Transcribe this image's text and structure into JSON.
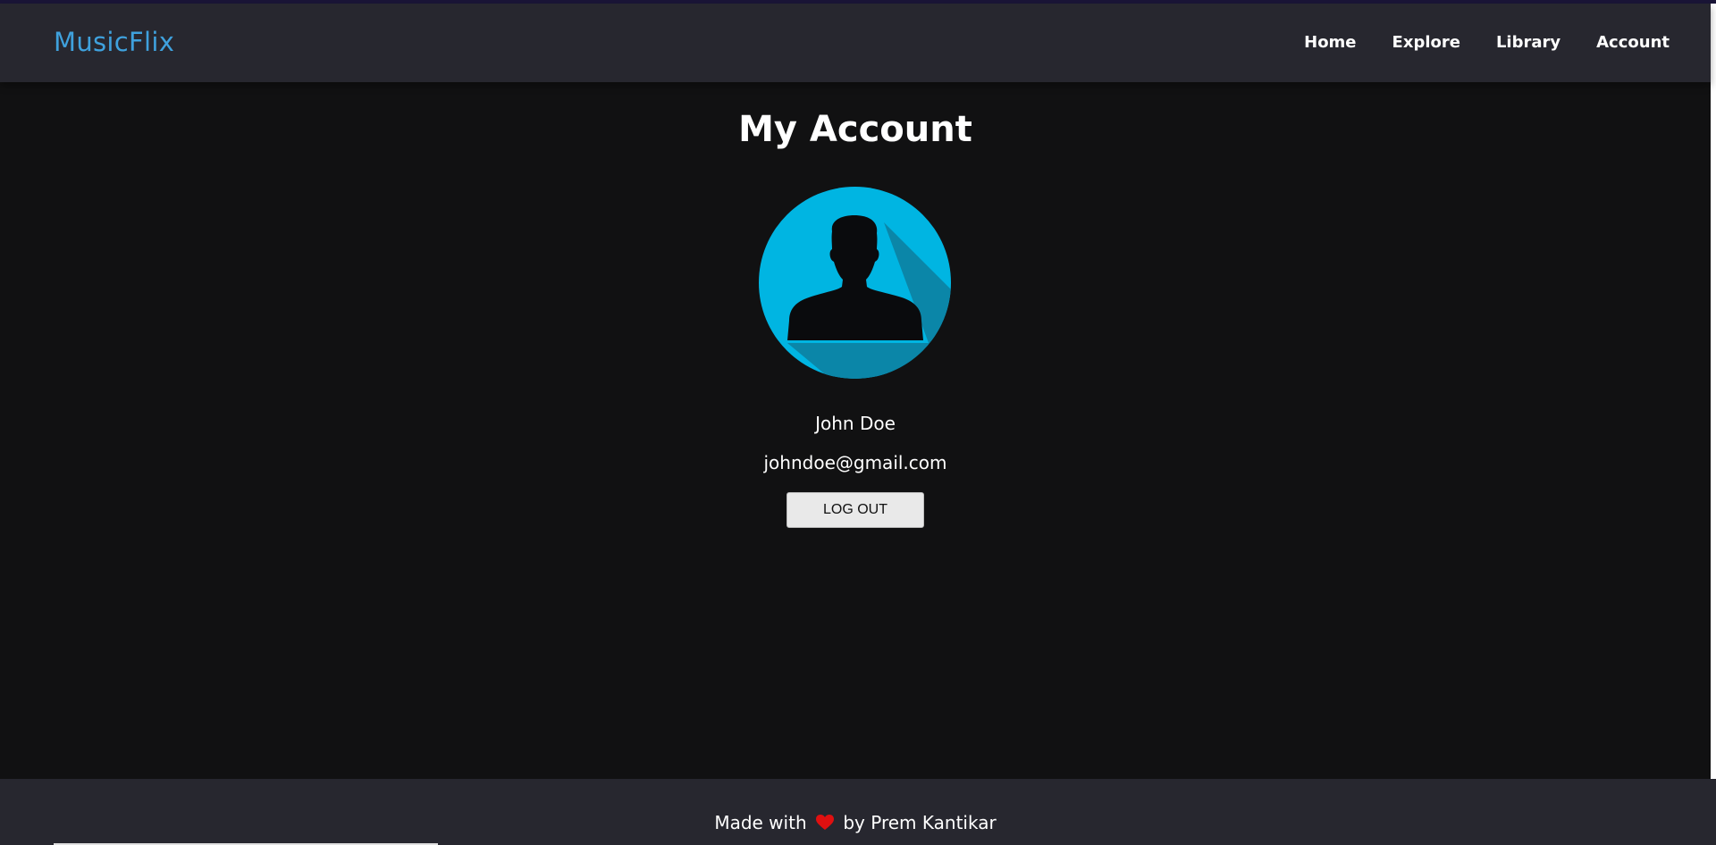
{
  "navbar": {
    "brand": "MusicFlix",
    "links": [
      {
        "label": "Home"
      },
      {
        "label": "Explore"
      },
      {
        "label": "Library"
      },
      {
        "label": "Account"
      }
    ]
  },
  "main": {
    "title": "My Account",
    "avatar_icon": "user-silhouette-icon",
    "user": {
      "name": "John Doe",
      "email": "johndoe@gmail.com"
    },
    "logout_label": "LOG OUT"
  },
  "footer": {
    "text_before": "Made with",
    "heart_icon": "heart-icon",
    "text_after": "by Prem Kantikar"
  },
  "colors": {
    "brand": "#3fa1dd",
    "navbar_bg": "#27272f",
    "page_bg": "#111112",
    "avatar_circle": "#00b5e2",
    "avatar_shadow": "#0b86a8",
    "heart": "#e01010"
  }
}
